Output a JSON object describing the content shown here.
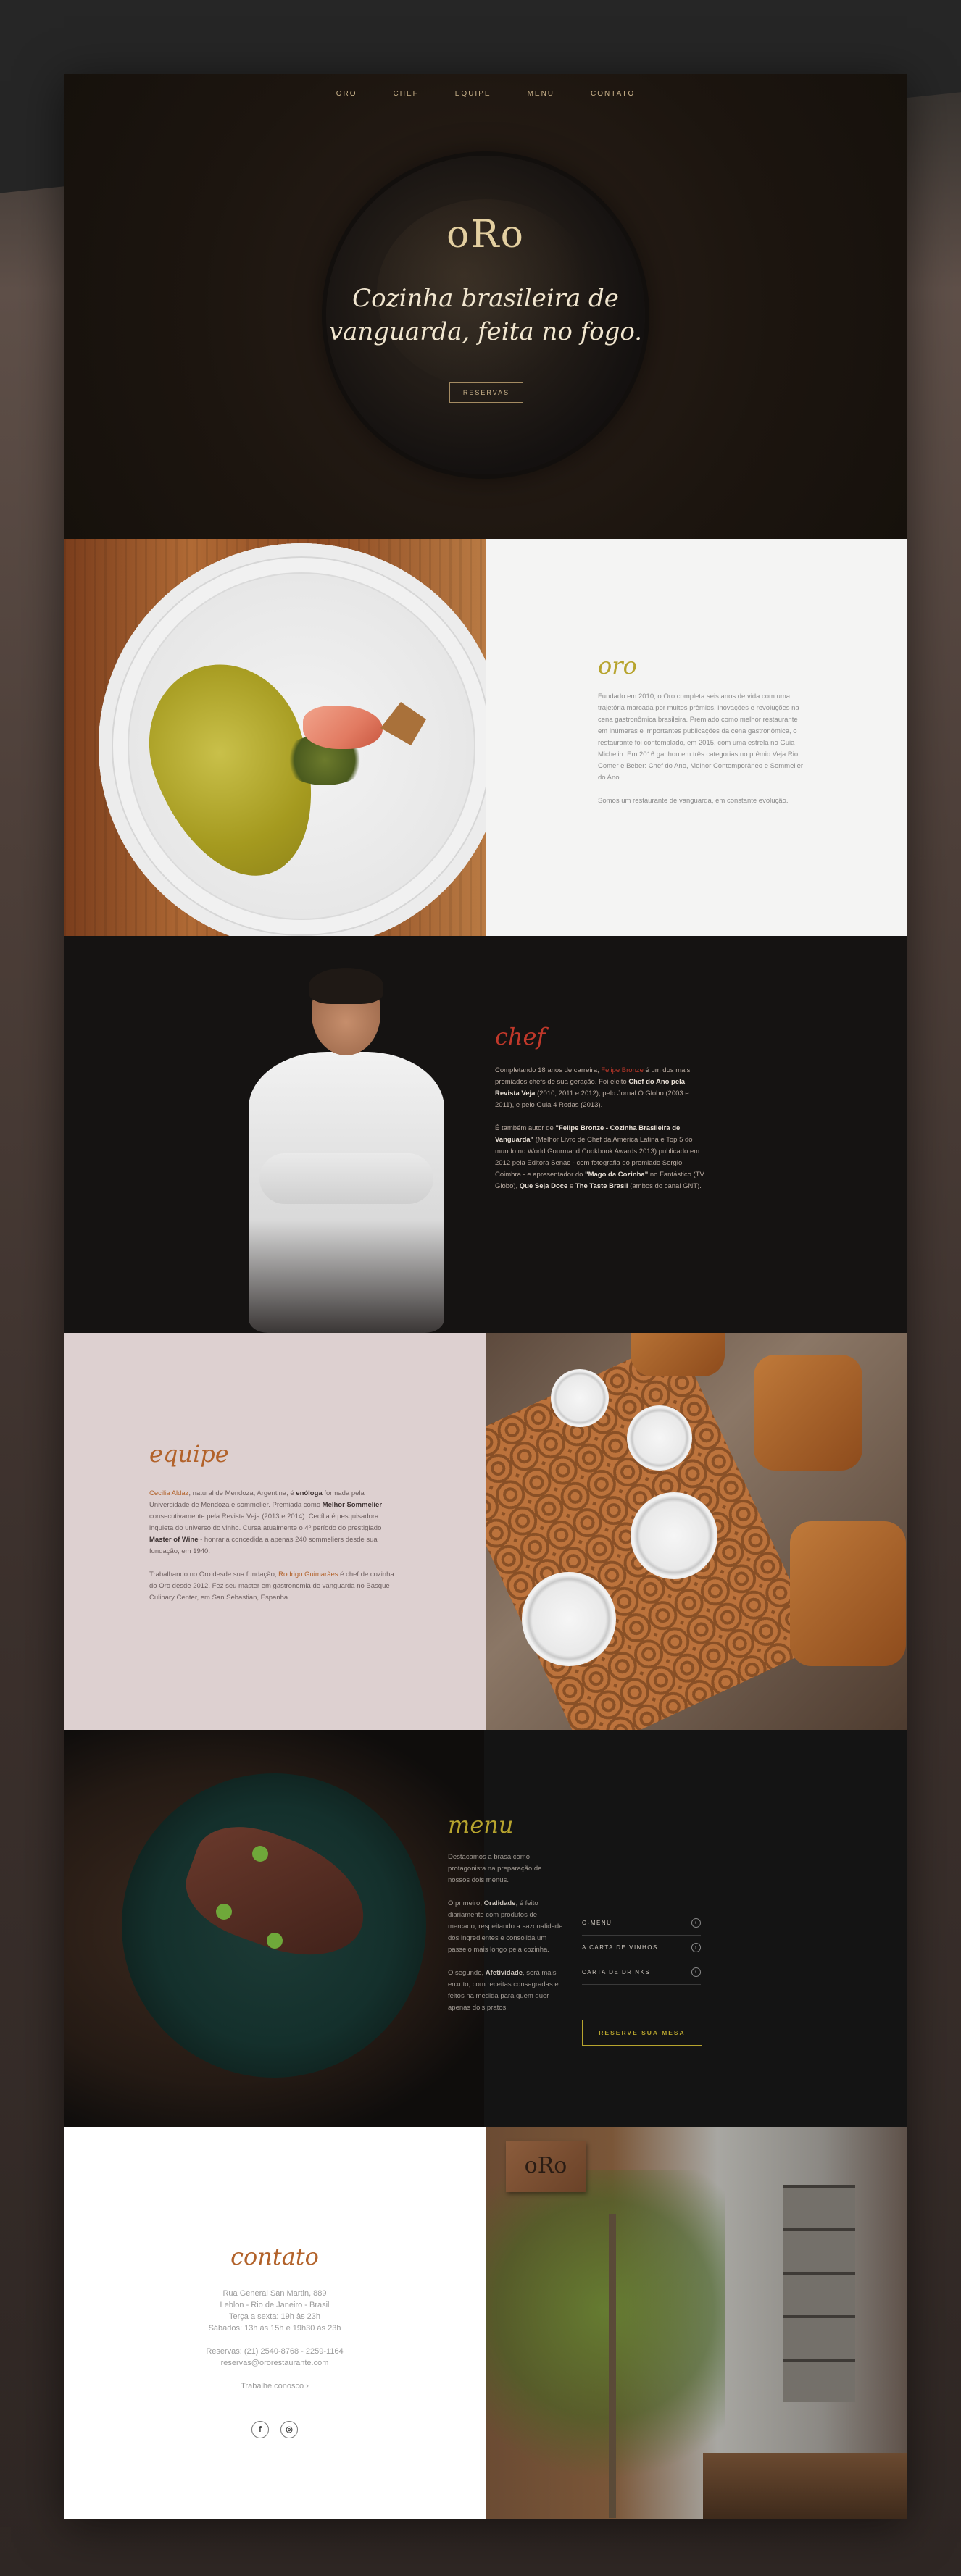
{
  "nav": [
    "ORO",
    "CHEF",
    "EQUIPE",
    "MENU",
    "CONTATO"
  ],
  "hero": {
    "logo": "oRo",
    "tagline_line1": "Cozinha brasileira de",
    "tagline_line2": "vanguarda, feita no fogo.",
    "button": "RESERVAS"
  },
  "oro": {
    "title": "oro",
    "p1": "Fundado em 2010, o Oro completa seis anos de vida com uma trajetória marcada por muitos prêmios, inovações e revoluções na cena gastronômica brasileira. Premiado como melhor restaurante em inúmeras e importantes publicações da cena gastronômica, o restaurante foi contemplado, em 2015, com uma estrela no Guia Michelin. Em 2016 ganhou em três categorias no prêmio Veja Rio Comer e Beber: Chef do Ano, Melhor Contemporâneo e Sommelier do Ano.",
    "p2": "Somos um restaurante de vanguarda, em constante evolução."
  },
  "chef": {
    "title": "chef",
    "p1_a": "Completando 18 anos de carreira, ",
    "p1_name": "Felipe Bronze",
    "p1_b": " é um dos mais premiados chefs de sua geração. Foi eleito ",
    "p1_bold1": "Chef do Ano pela Revista Veja",
    "p1_c": " (2010, 2011 e 2012), pelo Jornal O Globo (2003 e 2011), e pelo Guia 4 Rodas (2013).",
    "p2_a": "É também autor de ",
    "p2_bold1": "\"Felipe Bronze - Cozinha Brasileira de Vanguarda\"",
    "p2_b": " (Melhor Livro de Chef da América Latina e Top 5 do mundo no World Gourmand Cookbook Awards 2013) publicado em 2012 pela Editora Senac - com fotografia do premiado Sergio Coimbra - e apresentador do ",
    "p2_bold2": "\"Mago da Cozinha\"",
    "p2_c": " no Fantástico (TV Globo), ",
    "p2_bold3": "Que Seja Doce",
    "p2_d": " e ",
    "p2_bold4": "The Taste Brasil",
    "p2_e": " (ambos do canal GNT)."
  },
  "equipe": {
    "title": "equipe",
    "p1_name": "Cecilia Aldaz",
    "p1_a": ", natural de Mendoza, Argentina, é ",
    "p1_bold1": "enóloga",
    "p1_b": " formada pela Universidade de Mendoza e sommelier. Premiada como ",
    "p1_bold2": "Melhor Sommelier",
    "p1_c": " consecutivamente pela Revista Veja (2013 e 2014). Cecília é pesquisadora inquieta do universo do vinho. Cursa atualmente o 4º período do prestigiado ",
    "p1_bold3": "Master of Wine",
    "p1_d": " - honraria concedida a apenas 240 sommeliers desde sua fundação, em 1940.",
    "p2_a": "Trabalhando no Oro desde sua fundação, ",
    "p2_name": "Rodrigo Guimarães",
    "p2_b": " é chef de cozinha do Oro desde 2012. Fez seu master em gastronomia de vanguarda no Basque Culinary Center, em San Sebastian, Espanha."
  },
  "menu": {
    "title": "menu",
    "p1": "Destacamos a brasa como protagonista na preparação de nossos dois menus.",
    "p2_a": "O primeiro, ",
    "p2_bold": "Oralidade",
    "p2_b": ", é feito diariamente com produtos de mercado, respeitando a sazonalidade dos ingredientes e consolida um passeio mais longo pela cozinha.",
    "p3_a": "O segundo, ",
    "p3_bold": "Afetividade",
    "p3_b": ", será mais enxuto, com receitas consagradas e feitos na medida para quem quer apenas dois pratos.",
    "links": [
      "O-MENU",
      "A CARTA DE VINHOS",
      "CARTA DE DRINKS"
    ],
    "button": "RESERVE SUA MESA"
  },
  "contato": {
    "title": "contato",
    "addr1": "Rua General San Martin, 889",
    "addr2": "Leblon - Rio de Janeiro - Brasil",
    "hours1": "Terça a sexta: 19h às 23h",
    "hours2": "Sábados: 13h às 15h e 19h30 às 23h",
    "phone": "Reservas: (21) 2540-8768 - 2259-1164",
    "email": "reservas@ororestaurante.com",
    "work": "Trabalhe conosco ›",
    "social_fb": "f",
    "social_ig": "◎",
    "sign": "oRo"
  }
}
